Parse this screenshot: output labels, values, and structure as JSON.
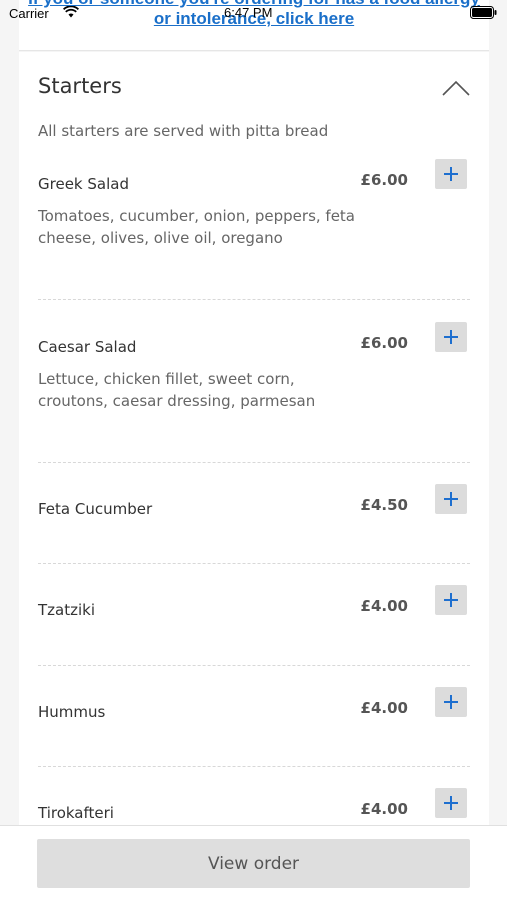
{
  "status_bar": {
    "carrier": "Carrier",
    "time": "6:47 PM"
  },
  "notice": {
    "link_text": "If you or someone you're ordering for has a food allergy or intolerance, click here"
  },
  "section": {
    "title": "Starters",
    "note": "All starters are served with pitta bread",
    "items": [
      {
        "name": "Greek Salad",
        "price": "£6.00",
        "description": "Tomatoes, cucumber, onion, peppers, feta cheese, olives, olive oil, oregano"
      },
      {
        "name": "Caesar Salad",
        "price": "£6.00",
        "description": "Lettuce, chicken fillet, sweet corn, croutons, caesar dressing, parmesan"
      },
      {
        "name": "Feta Cucumber",
        "price": "£4.50"
      },
      {
        "name": "Tzatziki",
        "price": "£4.00"
      },
      {
        "name": "Hummus",
        "price": "£4.00"
      },
      {
        "name": "Tirokafteri",
        "price": "£4.00"
      }
    ]
  },
  "footer": {
    "view_order_label": "View order"
  },
  "icons": {
    "wifi": "wifi-icon",
    "battery": "battery-icon",
    "collapse": "chevron-up-icon",
    "add": "plus-icon"
  },
  "colors": {
    "link": "#1a6fc9",
    "add_icon": "#1e6fcf",
    "button_bg": "#dedede"
  }
}
